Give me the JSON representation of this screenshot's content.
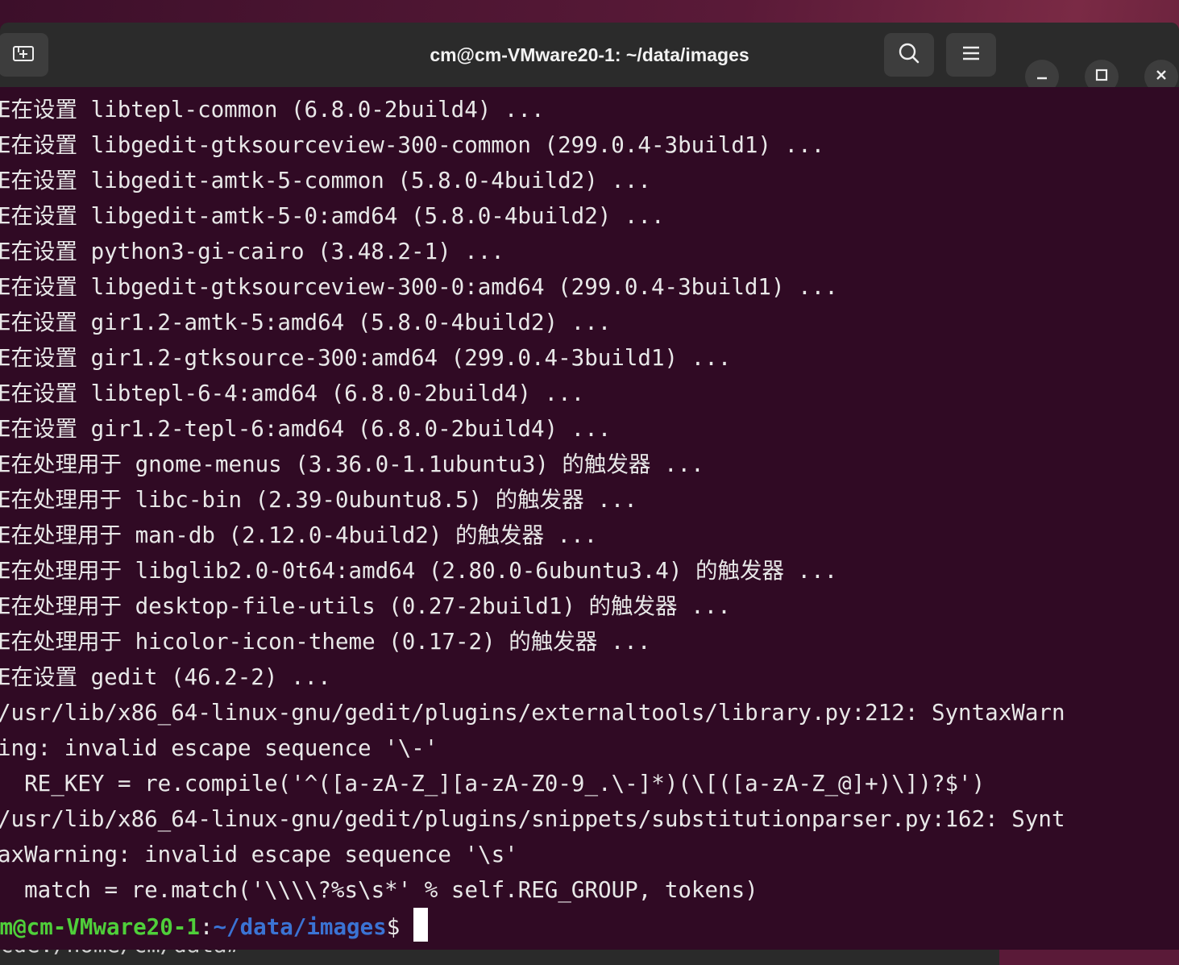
{
  "window": {
    "title": "cm@cm-VMware20-1: ~/data/images",
    "buttons": {
      "new_tab_icon": "new-tab-icon",
      "search_icon": "search-icon",
      "menu_icon": "hamburger-menu-icon",
      "minimize_icon": "minimize-icon",
      "maximize_icon": "maximize-icon",
      "close_icon": "close-icon"
    }
  },
  "terminal": {
    "lines": [
      "E在设置 libtepl-common (6.8.0-2build4) ...",
      "E在设置 libgedit-gtksourceview-300-common (299.0.4-3build1) ...",
      "E在设置 libgedit-amtk-5-common (5.8.0-4build2) ...",
      "E在设置 libgedit-amtk-5-0:amd64 (5.8.0-4build2) ...",
      "E在设置 python3-gi-cairo (3.48.2-1) ...",
      "E在设置 libgedit-gtksourceview-300-0:amd64 (299.0.4-3build1) ...",
      "E在设置 gir1.2-amtk-5:amd64 (5.8.0-4build2) ...",
      "E在设置 gir1.2-gtksource-300:amd64 (299.0.4-3build1) ...",
      "E在设置 libtepl-6-4:amd64 (6.8.0-2build4) ...",
      "E在设置 gir1.2-tepl-6:amd64 (6.8.0-2build4) ...",
      "E在处理用于 gnome-menus (3.36.0-1.1ubuntu3) 的触发器 ...",
      "E在处理用于 libc-bin (2.39-0ubuntu8.5) 的触发器 ...",
      "E在处理用于 man-db (2.12.0-4build2) 的触发器 ...",
      "E在处理用于 libglib2.0-0t64:amd64 (2.80.0-6ubuntu3.4) 的触发器 ...",
      "E在处理用于 desktop-file-utils (0.27-2build1) 的触发器 ...",
      "E在处理用于 hicolor-icon-theme (0.17-2) 的触发器 ...",
      "E在设置 gedit (46.2-2) ...",
      "/usr/lib/x86_64-linux-gnu/gedit/plugins/externaltools/library.py:212: SyntaxWarn",
      "ing: invalid escape sequence '\\-'",
      "  RE_KEY = re.compile('^([a-zA-Z_][a-zA-Z0-9_.\\-]*)(\\[([a-zA-Z_@]+)\\])?$')",
      "/usr/lib/x86_64-linux-gnu/gedit/plugins/snippets/substitutionparser.py:162: Synt",
      "axWarning: invalid escape sequence '\\s'",
      "  match = re.match('\\\\\\\\?%s\\s*' % self.REG_GROUP, tokens)"
    ],
    "prompt": {
      "user_host": "cm@cm-VMware20-1",
      "separator": ":",
      "path": "~/data/images",
      "symbol": "$ "
    },
    "obscured_line": "cde:/home/cm/data# "
  }
}
